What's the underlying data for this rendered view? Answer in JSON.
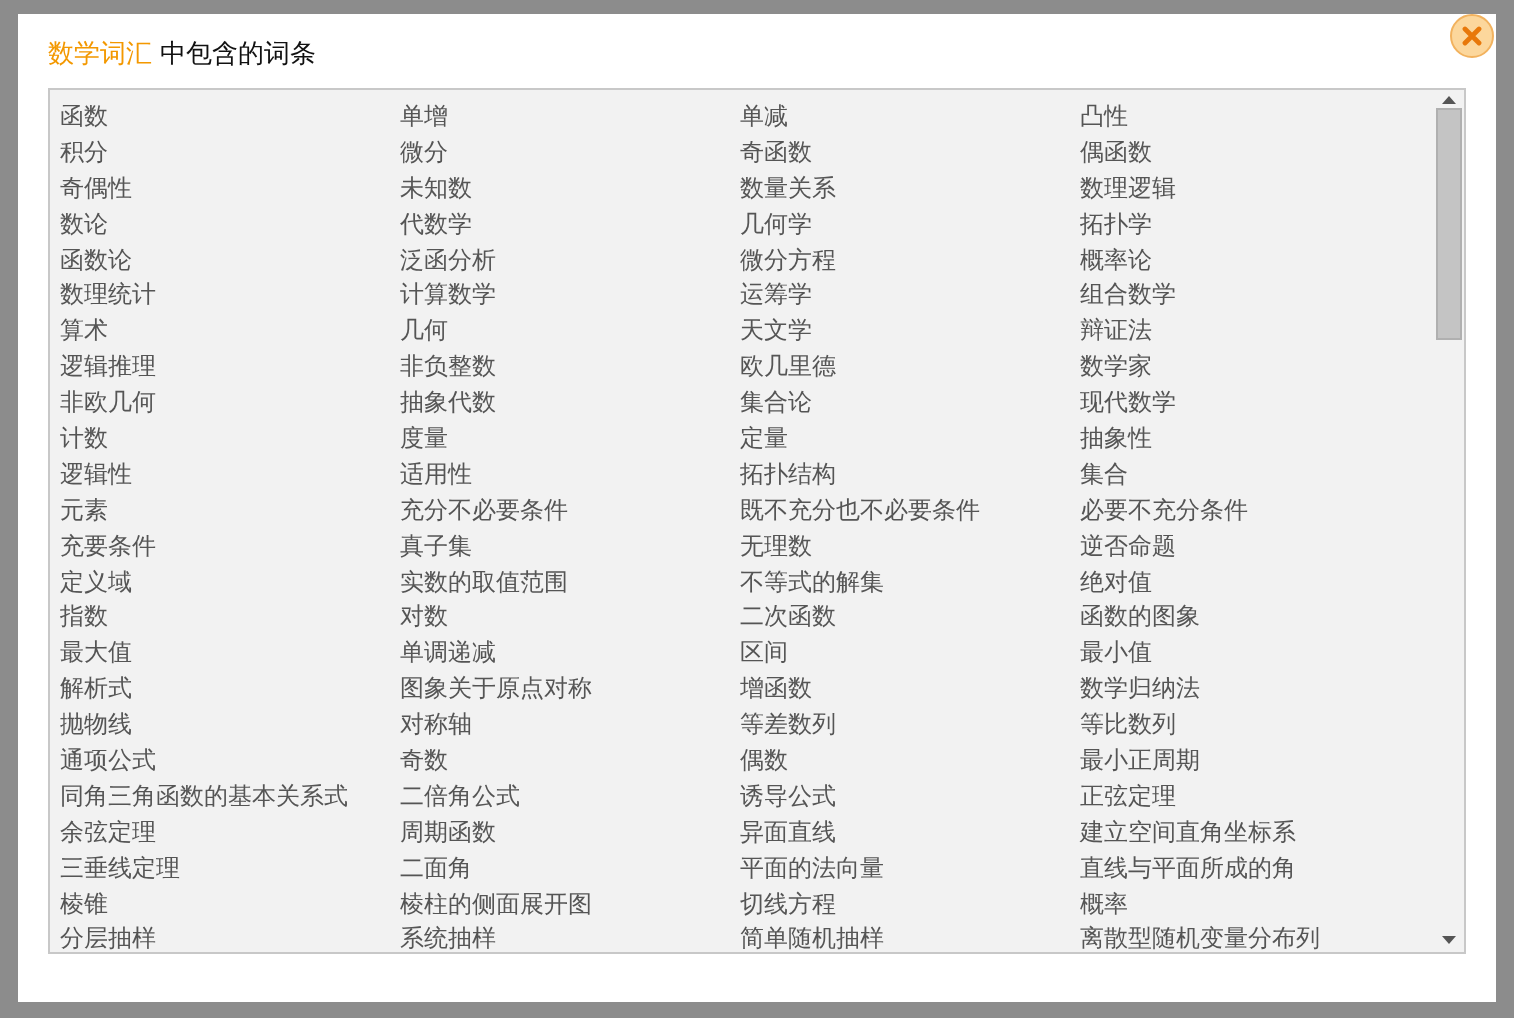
{
  "dialog": {
    "title_highlight": "数学词汇",
    "title_rest": "中包含的词条"
  },
  "terms": [
    [
      "函数",
      "单增",
      "单减",
      "凸性"
    ],
    [
      "积分",
      "微分",
      "奇函数",
      "偶函数"
    ],
    [
      "奇偶性",
      "未知数",
      "数量关系",
      "数理逻辑"
    ],
    [
      "数论",
      "代数学",
      "几何学",
      "拓扑学"
    ],
    [
      "函数论",
      "泛函分析",
      "微分方程",
      "概率论"
    ],
    [
      "数理统计",
      "计算数学",
      "运筹学",
      "组合数学"
    ],
    [
      "算术",
      "几何",
      "天文学",
      "辩证法"
    ],
    [
      "逻辑推理",
      "非负整数",
      "欧几里德",
      "数学家"
    ],
    [
      "非欧几何",
      "抽象代数",
      "集合论",
      "现代数学"
    ],
    [
      "计数",
      "度量",
      "定量",
      "抽象性"
    ],
    [
      "逻辑性",
      "适用性",
      "拓扑结构",
      "集合"
    ],
    [
      "元素",
      "充分不必要条件",
      "既不充分也不必要条件",
      "必要不充分条件"
    ],
    [
      "充要条件",
      "真子集",
      "无理数",
      "逆否命题"
    ],
    [
      "定义域",
      "实数的取值范围",
      "不等式的解集",
      "绝对值"
    ],
    [
      "指数",
      "对数",
      "二次函数",
      "函数的图象"
    ],
    [
      "最大值",
      "单调递减",
      "区间",
      "最小值"
    ],
    [
      "解析式",
      "图象关于原点对称",
      "增函数",
      "数学归纳法"
    ],
    [
      "抛物线",
      "对称轴",
      "等差数列",
      "等比数列"
    ],
    [
      "通项公式",
      "奇数",
      "偶数",
      "最小正周期"
    ],
    [
      "同角三角函数的基本关系式",
      "二倍角公式",
      "诱导公式",
      "正弦定理"
    ],
    [
      "余弦定理",
      "周期函数",
      "异面直线",
      "建立空间直角坐标系"
    ],
    [
      "三垂线定理",
      "二面角",
      "平面的法向量",
      "直线与平面所成的角"
    ],
    [
      "棱锥",
      "棱柱的侧面展开图",
      "切线方程",
      "概率"
    ],
    [
      "分层抽样",
      "系统抽样",
      "简单随机抽样",
      "离散型随机变量分布列"
    ]
  ]
}
